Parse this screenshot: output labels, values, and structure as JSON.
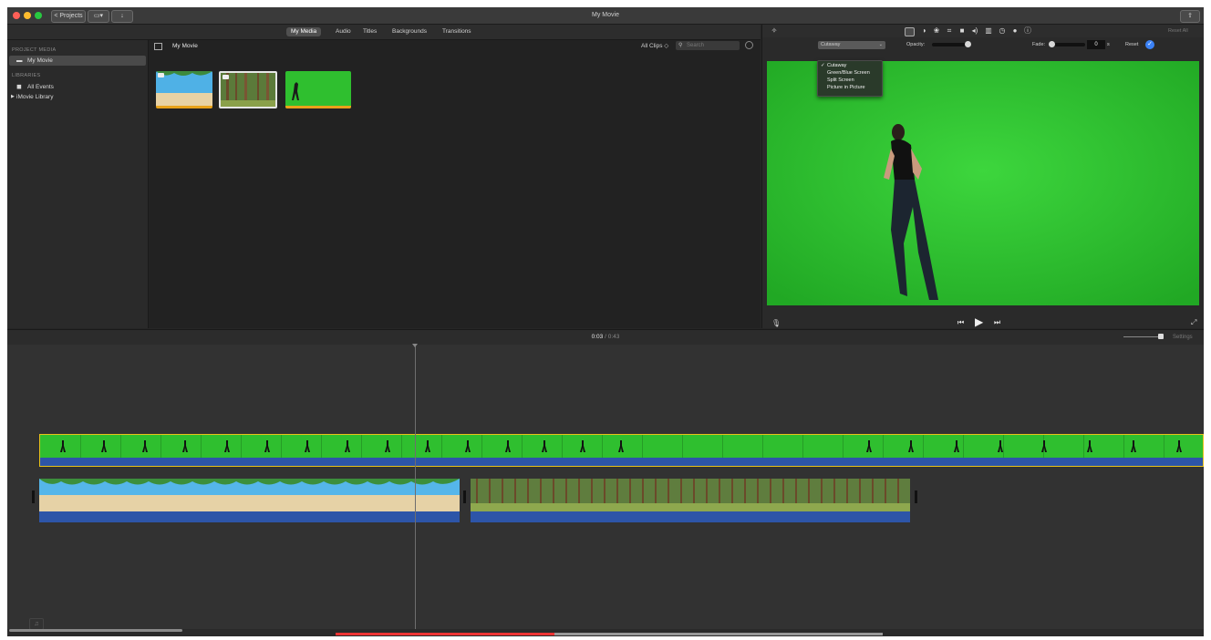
{
  "titlebar": {
    "projects_label": "< Projects",
    "window_title": "My Movie"
  },
  "media_tabs": [
    "My Media",
    "Audio",
    "Titles",
    "Backgrounds",
    "Transitions"
  ],
  "sidebar": {
    "project_media_header": "PROJECT MEDIA",
    "project_item": "My Movie",
    "libraries_header": "LIBRARIES",
    "all_events": "All Events",
    "library": "iMovie Library"
  },
  "browser": {
    "title": "My Movie",
    "filter": "All Clips ◇",
    "search_placeholder": "Search"
  },
  "viewer": {
    "reset_all": "Reset All",
    "overlay_mode": "Cutaway",
    "opacity_label": "Opacity:",
    "fade_label": "Fade:",
    "fade_value": "0",
    "fade_unit": "s",
    "reset_label": "Reset"
  },
  "dropdown": {
    "items": [
      "Cutaway",
      "Green/Blue Screen",
      "Split Screen",
      "Picture in Picture"
    ],
    "checked": "✓"
  },
  "timeline": {
    "current_time": "0:03",
    "separator": "/",
    "total_time": "0:43",
    "settings_label": "Settings"
  },
  "colors": {
    "green_screen": "#2fbf2f",
    "audio_blue": "#2d55a8",
    "selection_yellow": "#e8c21a",
    "accent_blue": "#3b82f6"
  }
}
